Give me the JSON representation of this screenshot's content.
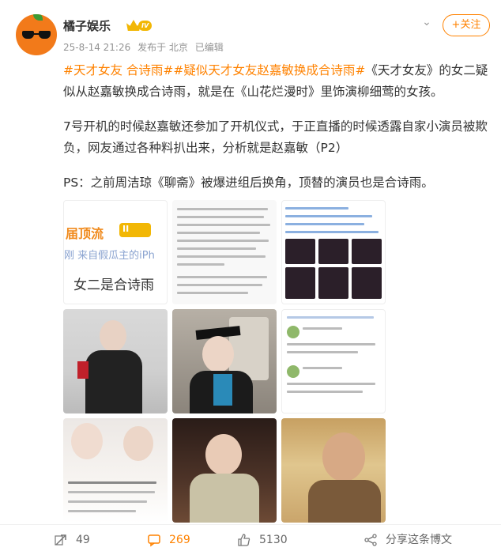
{
  "post": {
    "username": "橘子娱乐",
    "vip_level": "IV",
    "date": "25-8-14 21:26",
    "location": "发布于 北京",
    "edited": "已编辑",
    "follow_label": "+关注",
    "paragraph1_tags": "#天才女友 合诗雨##疑似天才女友赵嘉敏换成合诗雨#",
    "paragraph1_text": "《天才女友》的女二疑似从赵嘉敏换成合诗雨，就是在《山花烂漫时》里饰演柳细莺的女孩。",
    "paragraph2": "7号开机的时候赵嘉敏还参加了开机仪式，于正直播的时候透露自家小演员被欺负，网友通过各种料扒出来，分析就是赵嘉敏（P2）",
    "paragraph3": "PS：之前周洁琼《聊斋》被爆进组后换角，顶替的演员也是合诗雨。"
  },
  "images": {
    "img1": {
      "line1": "届顶流",
      "badge": "II",
      "line2": "刚  来自假瓜主的iPh",
      "line3": "女二是合诗雨"
    }
  },
  "footer": {
    "repost_count": "49",
    "comment_count": "269",
    "like_count": "5130",
    "share_label": "分享这条博文"
  },
  "colors": {
    "accent": "#ff8200",
    "topic": "#ff8200",
    "gold": "#f2b705"
  }
}
